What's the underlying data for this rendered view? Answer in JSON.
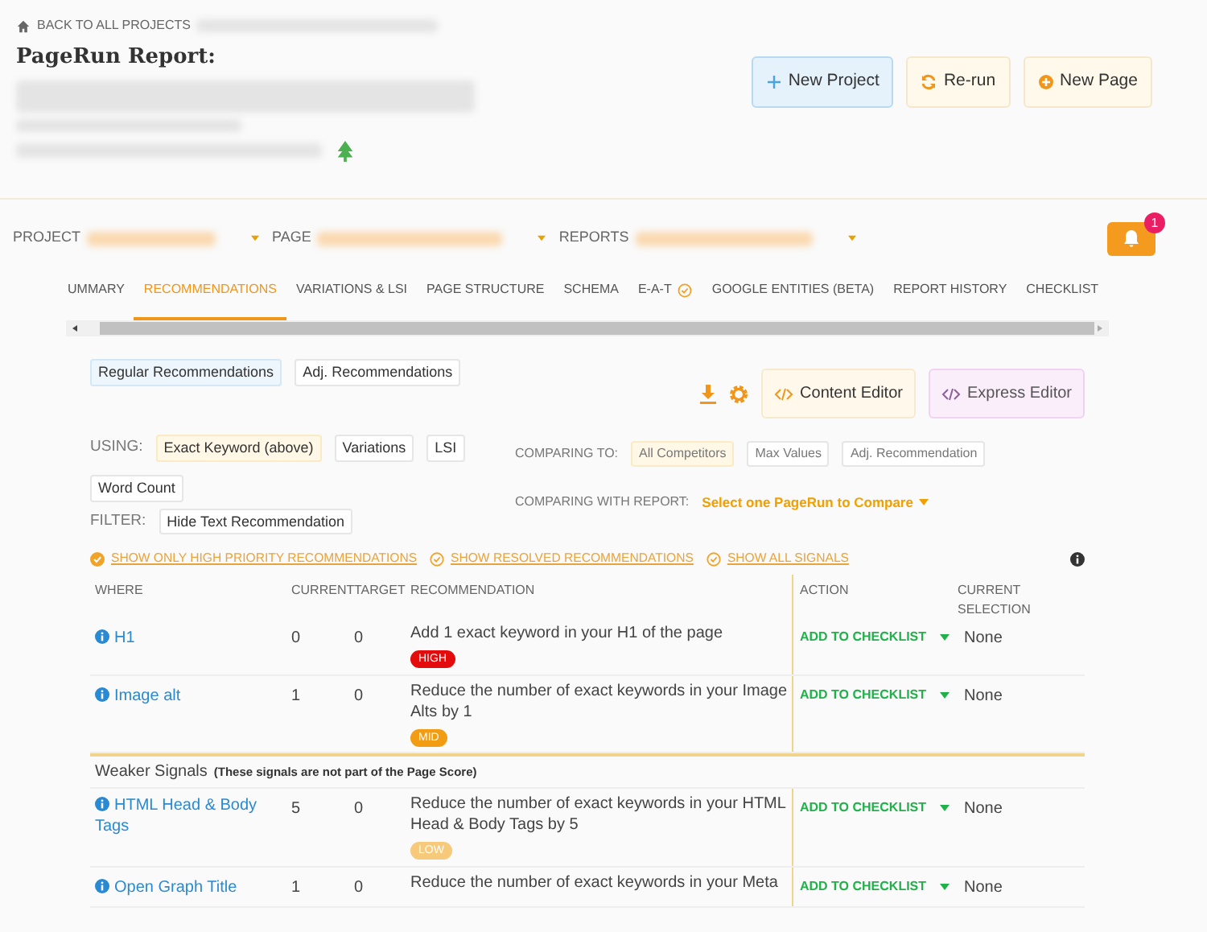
{
  "header": {
    "back_link": "BACK TO ALL PROJECTS",
    "report_label": "PageRun Report:",
    "buttons": [
      {
        "label": "New Project",
        "kind": "project"
      },
      {
        "label": "Re-run",
        "kind": "rerun"
      },
      {
        "label": "New Page",
        "kind": "page"
      }
    ]
  },
  "selectors": [
    {
      "label": "PROJECT"
    },
    {
      "label": "PAGE"
    },
    {
      "label": "REPORTS"
    }
  ],
  "notification_count": "1",
  "tabs": [
    {
      "label": "UMMARY",
      "selected": false,
      "verified": false
    },
    {
      "label": "RECOMMENDATIONS",
      "selected": true,
      "verified": false
    },
    {
      "label": "VARIATIONS & LSI",
      "selected": false,
      "verified": false
    },
    {
      "label": "PAGE STRUCTURE",
      "selected": false,
      "verified": false
    },
    {
      "label": "SCHEMA",
      "selected": false,
      "verified": false
    },
    {
      "label": "E-A-T",
      "selected": false,
      "verified": true
    },
    {
      "label": "GOOGLE ENTITIES (BETA)",
      "selected": false,
      "verified": false
    },
    {
      "label": "REPORT HISTORY",
      "selected": false,
      "verified": false
    },
    {
      "label": "CHECKLIST",
      "selected": false,
      "verified": false
    }
  ],
  "recommendation_types": [
    {
      "label": "Regular Recommendations",
      "selected": true
    },
    {
      "label": "Adj. Recommendations",
      "selected": false
    }
  ],
  "editors": [
    {
      "label": "Content Editor",
      "kind": "content"
    },
    {
      "label": "Express Editor",
      "kind": "express"
    }
  ],
  "using": {
    "label": "USING:",
    "options": [
      {
        "label": "Exact Keyword (above)",
        "selected": true
      },
      {
        "label": "Variations",
        "selected": false
      },
      {
        "label": "LSI",
        "selected": false
      },
      {
        "label": "Word Count",
        "selected": false
      }
    ]
  },
  "filter": {
    "label": "FILTER:",
    "options": [
      {
        "label": "Hide Text Recommendation",
        "selected": false
      }
    ]
  },
  "comparing_to": {
    "label": "COMPARING TO:",
    "options": [
      {
        "label": "All Competitors",
        "selected": true
      },
      {
        "label": "Max Values",
        "selected": false
      },
      {
        "label": "Adj. Recommendation",
        "selected": false
      }
    ]
  },
  "comparing_with_report": {
    "label": "COMPARING WITH REPORT:",
    "value": "Select one PageRun to Compare"
  },
  "toggles": [
    {
      "label": "SHOW ONLY HIGH PRIORITY RECOMMENDATIONS",
      "checked": true
    },
    {
      "label": "SHOW RESOLVED RECOMMENDATIONS",
      "checked": false
    },
    {
      "label": "SHOW ALL SIGNALS",
      "checked": false
    }
  ],
  "table": {
    "columns": [
      "WHERE",
      "CURRENT",
      "TARGET",
      "RECOMMENDATION",
      "ACTION",
      "CURRENT SELECTION"
    ],
    "rows": [
      {
        "kind": "row",
        "where": "H1",
        "current": "0",
        "target": "0",
        "recommendation": "Add 1 exact keyword in your H1 of the page",
        "priority": "HIGH",
        "color": "#e30b0b",
        "action": "ADD TO CHECKLIST",
        "selection": "None"
      },
      {
        "kind": "row",
        "where": "Image alt",
        "current": "1",
        "target": "0",
        "recommendation": "Reduce the number of exact keywords in your Image Alts by 1",
        "priority": "MID",
        "color": "#f29c14",
        "action": "ADD TO CHECKLIST",
        "selection": "None"
      },
      {
        "kind": "group",
        "title": "Weaker Signals",
        "note": "(These signals are not part of the Page Score)"
      },
      {
        "kind": "row",
        "where": "HTML Head & Body Tags",
        "current": "5",
        "target": "0",
        "recommendation": "Reduce the number of exact keywords in your HTML Head & Body Tags by 5",
        "priority": "LOW",
        "color": "#f7c97a",
        "action": "ADD TO CHECKLIST",
        "selection": "None"
      },
      {
        "kind": "row",
        "where": "Open Graph Title",
        "current": "1",
        "target": "0",
        "recommendation": "Reduce the number of exact keywords in your Meta",
        "action": "ADD TO CHECKLIST",
        "selection": "None"
      }
    ]
  }
}
